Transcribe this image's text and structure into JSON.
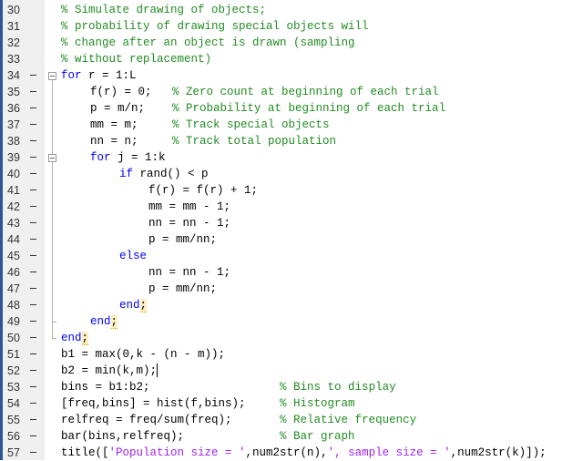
{
  "editor": {
    "lines": [
      {
        "num": "30",
        "exec": false,
        "indent": 0,
        "segments": [
          {
            "t": "cm",
            "v": "% Simulate drawing of objects;"
          }
        ]
      },
      {
        "num": "31",
        "exec": false,
        "indent": 0,
        "segments": [
          {
            "t": "cm",
            "v": "% probability of drawing special objects will"
          }
        ]
      },
      {
        "num": "32",
        "exec": false,
        "indent": 0,
        "segments": [
          {
            "t": "cm",
            "v": "% change after an object is drawn (sampling"
          }
        ]
      },
      {
        "num": "33",
        "exec": false,
        "indent": 0,
        "segments": [
          {
            "t": "cm",
            "v": "% without replacement)"
          }
        ]
      },
      {
        "num": "34",
        "exec": true,
        "indent": 0,
        "segments": [
          {
            "t": "kw",
            "v": "for"
          },
          {
            "t": "tx",
            "v": " r = 1:L"
          }
        ]
      },
      {
        "num": "35",
        "exec": true,
        "indent": 1,
        "segments": [
          {
            "t": "tx",
            "v": "f(r) = 0;   "
          },
          {
            "t": "cm",
            "v": "% Zero count at beginning of each trial"
          }
        ]
      },
      {
        "num": "36",
        "exec": true,
        "indent": 1,
        "segments": [
          {
            "t": "tx",
            "v": "p = m/n;    "
          },
          {
            "t": "cm",
            "v": "% Probability at beginning of each trial"
          }
        ]
      },
      {
        "num": "37",
        "exec": true,
        "indent": 1,
        "segments": [
          {
            "t": "tx",
            "v": "mm = m;     "
          },
          {
            "t": "cm",
            "v": "% Track special objects"
          }
        ]
      },
      {
        "num": "38",
        "exec": true,
        "indent": 1,
        "segments": [
          {
            "t": "tx",
            "v": "nn = n;     "
          },
          {
            "t": "cm",
            "v": "% Track total population"
          }
        ]
      },
      {
        "num": "39",
        "exec": true,
        "indent": 1,
        "segments": [
          {
            "t": "kw",
            "v": "for"
          },
          {
            "t": "tx",
            "v": " j = 1:k"
          }
        ]
      },
      {
        "num": "40",
        "exec": true,
        "indent": 2,
        "segments": [
          {
            "t": "kw",
            "v": "if"
          },
          {
            "t": "tx",
            "v": " rand() < p"
          }
        ]
      },
      {
        "num": "41",
        "exec": true,
        "indent": 3,
        "segments": [
          {
            "t": "tx",
            "v": "f(r) = f(r) + 1;"
          }
        ]
      },
      {
        "num": "42",
        "exec": true,
        "indent": 3,
        "segments": [
          {
            "t": "tx",
            "v": "mm = mm - 1;"
          }
        ]
      },
      {
        "num": "43",
        "exec": true,
        "indent": 3,
        "segments": [
          {
            "t": "tx",
            "v": "nn = nn - 1;"
          }
        ]
      },
      {
        "num": "44",
        "exec": true,
        "indent": 3,
        "segments": [
          {
            "t": "tx",
            "v": "p = mm/nn;"
          }
        ]
      },
      {
        "num": "45",
        "exec": true,
        "indent": 2,
        "segments": [
          {
            "t": "kw",
            "v": "else"
          }
        ]
      },
      {
        "num": "46",
        "exec": true,
        "indent": 3,
        "segments": [
          {
            "t": "tx",
            "v": "nn = nn - 1;"
          }
        ]
      },
      {
        "num": "47",
        "exec": true,
        "indent": 3,
        "segments": [
          {
            "t": "tx",
            "v": "p = mm/nn;"
          }
        ]
      },
      {
        "num": "48",
        "exec": true,
        "indent": 2,
        "segments": [
          {
            "t": "kw",
            "v": "end"
          },
          {
            "t": "hl",
            "v": ";"
          }
        ]
      },
      {
        "num": "49",
        "exec": true,
        "indent": 1,
        "segments": [
          {
            "t": "kw",
            "v": "end"
          },
          {
            "t": "hl",
            "v": ";"
          }
        ]
      },
      {
        "num": "50",
        "exec": true,
        "indent": 0,
        "segments": [
          {
            "t": "kw",
            "v": "end"
          },
          {
            "t": "hl",
            "v": ";"
          }
        ]
      },
      {
        "num": "51",
        "exec": true,
        "indent": 0,
        "segments": [
          {
            "t": "tx",
            "v": "b1 = max(0,k - (n - m));"
          }
        ]
      },
      {
        "num": "52",
        "exec": true,
        "indent": 0,
        "segments": [
          {
            "t": "tx",
            "v": "b2 = min(k,m);"
          },
          {
            "t": "cursor",
            "v": ""
          }
        ]
      },
      {
        "num": "53",
        "exec": true,
        "indent": 0,
        "segments": [
          {
            "t": "tx",
            "v": "bins = b1:b2;                   "
          },
          {
            "t": "cm",
            "v": "% Bins to display"
          }
        ]
      },
      {
        "num": "54",
        "exec": true,
        "indent": 0,
        "segments": [
          {
            "t": "tx",
            "v": "[freq,bins] = hist(f,bins);     "
          },
          {
            "t": "cm",
            "v": "% Histogram"
          }
        ]
      },
      {
        "num": "55",
        "exec": true,
        "indent": 0,
        "segments": [
          {
            "t": "tx",
            "v": "relfreq = freq/sum(freq);       "
          },
          {
            "t": "cm",
            "v": "% Relative frequency"
          }
        ]
      },
      {
        "num": "56",
        "exec": true,
        "indent": 0,
        "segments": [
          {
            "t": "tx",
            "v": "bar(bins,relfreq);              "
          },
          {
            "t": "cm",
            "v": "% Bar graph"
          }
        ]
      },
      {
        "num": "57",
        "exec": true,
        "indent": 0,
        "segments": [
          {
            "t": "tx",
            "v": "title(["
          },
          {
            "t": "str",
            "v": "'Population size = '"
          },
          {
            "t": "tx",
            "v": ",num2str(n),"
          },
          {
            "t": "str",
            "v": "', sample size = '"
          },
          {
            "t": "tx",
            "v": ",num2str(k)]);"
          }
        ]
      }
    ],
    "colors": {
      "keyword": "#0000ff",
      "comment": "#228b22",
      "string": "#a020f0",
      "text": "#000000"
    }
  }
}
